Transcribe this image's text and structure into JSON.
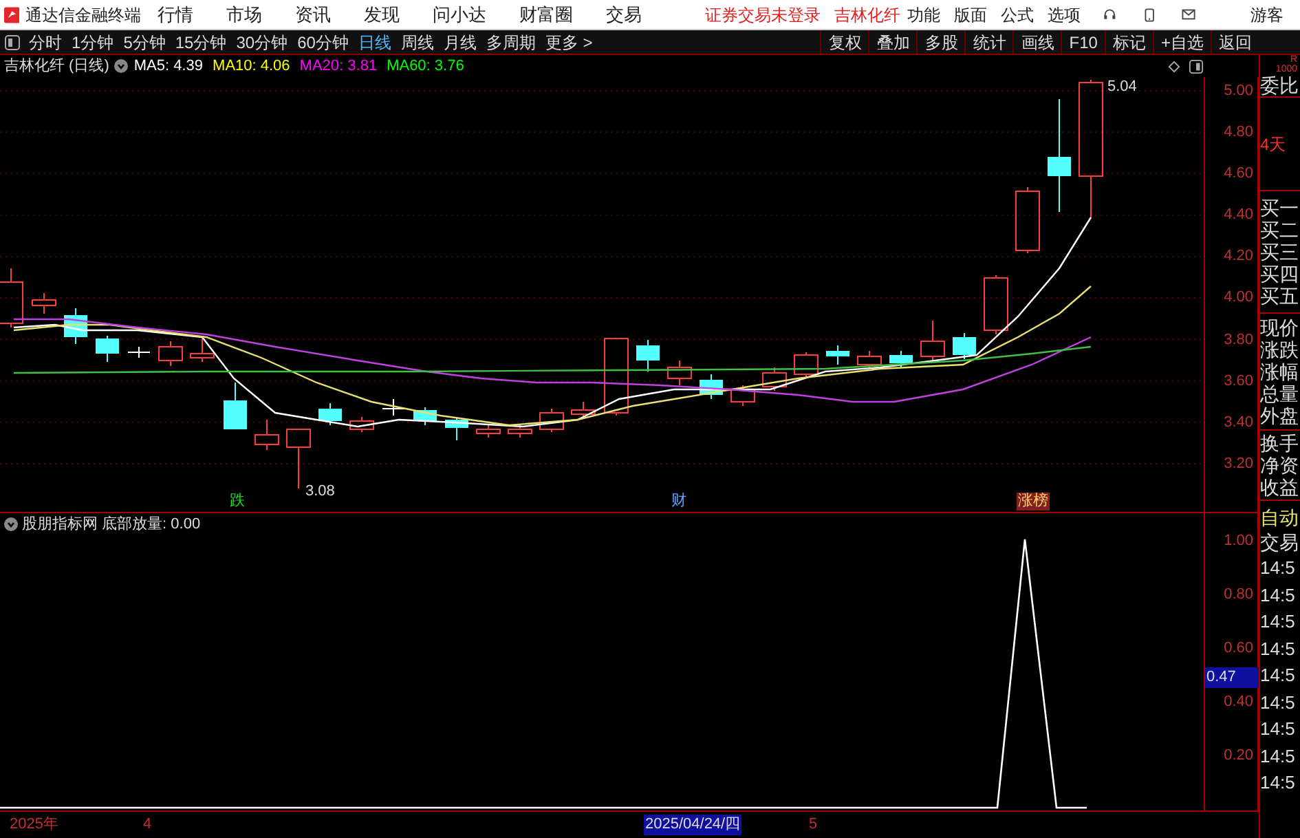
{
  "title_bar": {
    "app_name": "通达信金融终端",
    "menus": [
      "行情",
      "市场",
      "资讯",
      "发现",
      "问小达",
      "财富圈",
      "交易"
    ],
    "notice": "证券交易未登录",
    "stock": "吉林化纤",
    "tools": [
      "功能",
      "版面",
      "公式",
      "选项"
    ],
    "user": "游客"
  },
  "period_bar": {
    "periods": [
      {
        "label": "分时",
        "selected": false
      },
      {
        "label": "1分钟",
        "selected": false
      },
      {
        "label": "5分钟",
        "selected": false
      },
      {
        "label": "15分钟",
        "selected": false
      },
      {
        "label": "30分钟",
        "selected": false
      },
      {
        "label": "60分钟",
        "selected": false
      },
      {
        "label": "日线",
        "selected": true
      },
      {
        "label": "周线",
        "selected": false
      },
      {
        "label": "月线",
        "selected": false
      },
      {
        "label": "多周期",
        "selected": false
      },
      {
        "label": "更多 >",
        "selected": false
      }
    ],
    "buttons": [
      "复权",
      "叠加",
      "多股",
      "统计",
      "画线",
      "F10",
      "标记",
      "+自选",
      "返回"
    ]
  },
  "chart": {
    "title": "吉林化纤 (日线)",
    "ma": [
      {
        "label": "MA5: 4.39",
        "color": "#ffffff"
      },
      {
        "label": "MA10: 4.06",
        "color": "#ffff00"
      },
      {
        "label": "MA20: 3.81",
        "color": "#ff00ff"
      },
      {
        "label": "MA60: 3.76",
        "color": "#00ff00"
      }
    ],
    "price_axis": [
      "5.00",
      "4.80",
      "4.60",
      "4.40",
      "4.20",
      "4.00",
      "3.80",
      "3.60",
      "3.40",
      "3.20"
    ],
    "high_label": "5.04",
    "low_label": "3.08",
    "markers": [
      {
        "label": "跌",
        "kind": "down"
      },
      {
        "label": "财",
        "kind": "finance"
      },
      {
        "label": "涨榜",
        "kind": "hot"
      }
    ]
  },
  "indicator": {
    "title": "股朋指标网 底部放量: 0.00",
    "axis": [
      "1.00",
      "0.80",
      "0.60",
      "0.40",
      "0.20"
    ],
    "cursor_value": "0.47"
  },
  "date_axis": [
    {
      "label": "2025年",
      "selected": false
    },
    {
      "label": "4",
      "selected": false
    },
    {
      "label": "2025/04/24/四",
      "selected": true
    },
    {
      "label": "5",
      "selected": false
    }
  ],
  "side_panel": {
    "corner": [
      "R",
      "1000"
    ],
    "ratio": "委比",
    "days": "4天",
    "bids": [
      "买一",
      "买二",
      "买三",
      "买四",
      "买五"
    ],
    "quote": [
      "现价",
      "涨跌",
      "涨幅",
      "总量",
      "外盘"
    ],
    "finance": [
      "换手",
      "净资",
      "收益"
    ],
    "auto": "自动",
    "trade": "交易",
    "times": [
      "14:5",
      "14:5",
      "14:5",
      "14:5",
      "14:5",
      "14:5",
      "14:5",
      "14:5",
      "14:5"
    ]
  }
}
